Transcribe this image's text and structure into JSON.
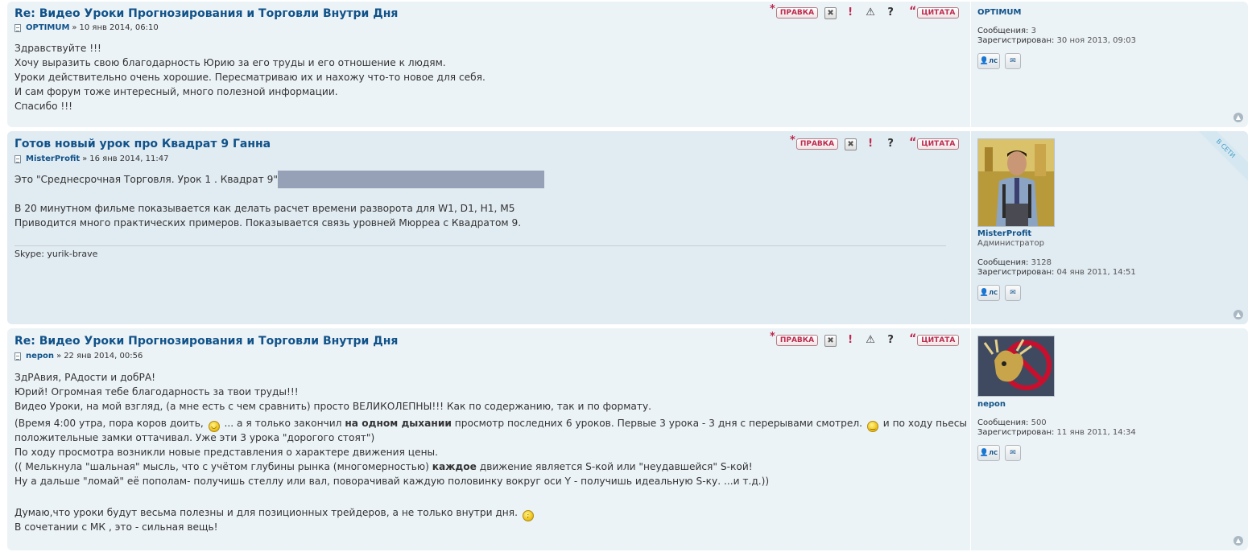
{
  "buttons": {
    "edit": "ПРАВКА",
    "quote": "ЦИТАТА",
    "delete_icon": "close-icon",
    "report_icon": "exclamation-icon",
    "warn_icon": "warning-icon",
    "info_icon": "question-icon",
    "pm": "ЛС",
    "top": "▲"
  },
  "posts": [
    {
      "title": "Re: Видео Уроки Прогнозирования и Торговли Внутри Дня",
      "author": "OPTIMUM",
      "sep": "»",
      "date": "10 янв 2014, 06:10",
      "lines": [
        "Здравствуйте !!!",
        "Хочу выразить свою благодарность Юрию за его труды и его отношение к людям.",
        "Уроки действительно очень хорошие. Пересматриваю их и нахожу что-то новое для себя.",
        "И сам форум тоже интересный, много полезной информации.",
        "Спасибо !!!"
      ],
      "profile": {
        "name": "OPTIMUM",
        "posts_label": "Сообщения:",
        "posts": "3",
        "reg_label": "Зарегистрирован:",
        "reg": "30 ноя 2013, 09:03"
      }
    },
    {
      "title": "Готов новый урок про Квадрат 9 Ганна",
      "author": "MisterProfit",
      "sep": "»",
      "date": "16 янв 2014, 11:47",
      "line1": "Это \"Среднесрочная Торговля. Урок 1 . Квадрат 9\"",
      "lines": [
        "В 20 минутном фильме показывается как делать расчет времени разворота для W1, D1, H1, M5",
        "Приводится много практических примеров. Показывается связь уровней Мюрреа с Квадратом 9."
      ],
      "signature": "Skype: yurik-brave",
      "online": "В СЕТИ",
      "profile": {
        "name": "MisterProfit",
        "rank": "Администратор",
        "posts_label": "Сообщения:",
        "posts": "3128",
        "reg_label": "Зарегистрирован:",
        "reg": "04 янв 2011, 14:51"
      }
    },
    {
      "title": "Re: Видео Уроки Прогнозирования и Торговли Внутри Дня",
      "author": "nepon",
      "sep": "»",
      "date": "22 янв 2014, 00:56",
      "l1": "ЗдРАвия, РАдости и добРА!",
      "l2": "Юрий! Огромная тебе благодарность за твои труды!!!",
      "l3": "Видео Уроки, на мой взгляд, (а мне есть с чем сравнить) просто ВЕЛИКОЛЕПНЫ!!! Как по содержанию, так и по формату.",
      "l4a": "(Время 4:00 утра, пора коров доить,",
      "l4b": "... а я только закончил",
      "l4bold": "на одном дыхании",
      "l4c": "просмотр последних 6 уроков. Первые 3 урока - 3 дня с перерывами смотрел.",
      "l4d": "и по ходу пьесы",
      "l5": "положительные замки оттачивал. Уже эти 3 урока \"дорогого стоят\")",
      "l6": "По ходу просмотра возникли новые представления о характере движения цены.",
      "l7a": "(( Мелькнула \"шальная\" мысль, что с учётом глубины рынка (многомерностью)",
      "l7bold": "каждое",
      "l7b": "движение является S-кой или \"неудавшейся\" S-кой!",
      "l8": "Ну а дальше \"ломай\" её пополам- получишь стеллу или вал, поворачивай каждую половинку вокруг оси Y - получишь идеальную S-ку. ...и т.д.))",
      "l9": "Думаю,что уроки будут весьма полезны и для позиционных трейдеров, а не только внутри дня.",
      "l10": "В сочетании с МК , это - сильная вещь!",
      "profile": {
        "name": "nepon",
        "posts_label": "Сообщения:",
        "posts": "500",
        "reg_label": "Зарегистрирован:",
        "reg": "11 янв 2011, 14:34"
      }
    }
  ]
}
